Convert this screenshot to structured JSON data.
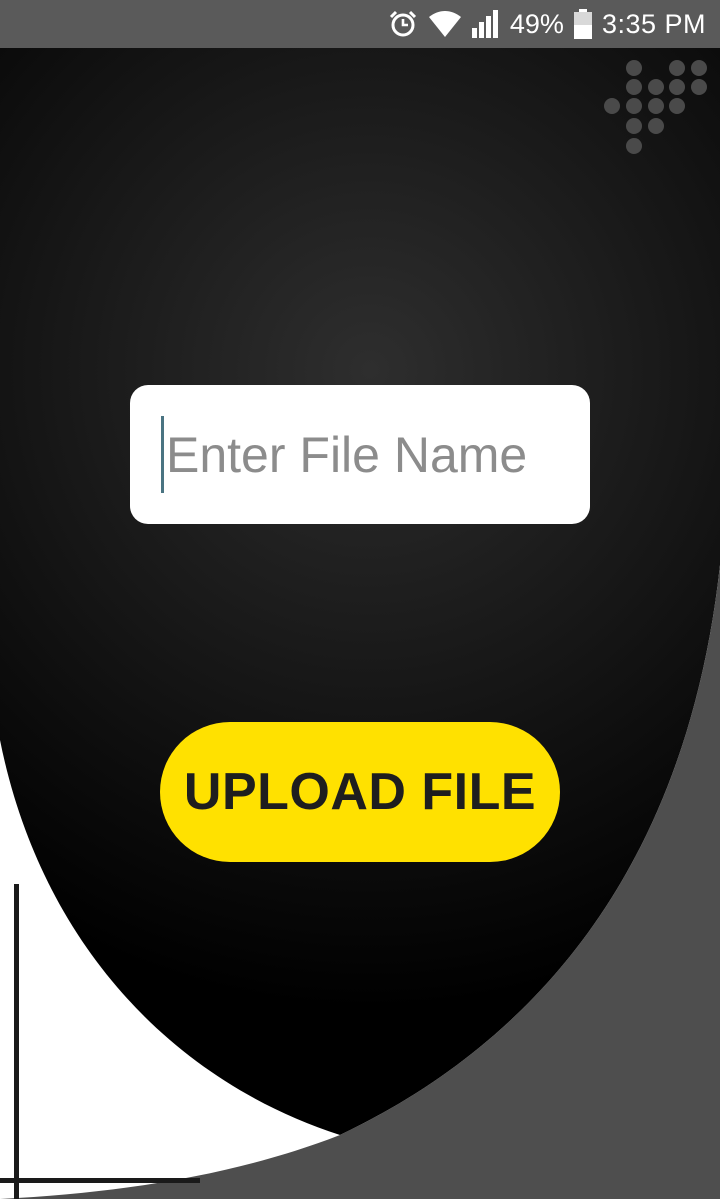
{
  "status_bar": {
    "icons": [
      "alarm-icon",
      "wifi-icon",
      "signal-icon",
      "battery-icon"
    ],
    "battery_percent": "49%",
    "time": "3:35 PM"
  },
  "form": {
    "file_name_placeholder": "Enter File Name",
    "file_name_value": "",
    "upload_button_label": "UPLOAD FILE"
  },
  "colors": {
    "status_bar": "#5a5a5a",
    "background_dark": "#000000",
    "background_glow": "#2e2e2e",
    "accent_gray": "#4e4e4e",
    "button_yellow": "#ffe100",
    "input_background": "#ffffff",
    "placeholder": "#8c8c8c"
  }
}
